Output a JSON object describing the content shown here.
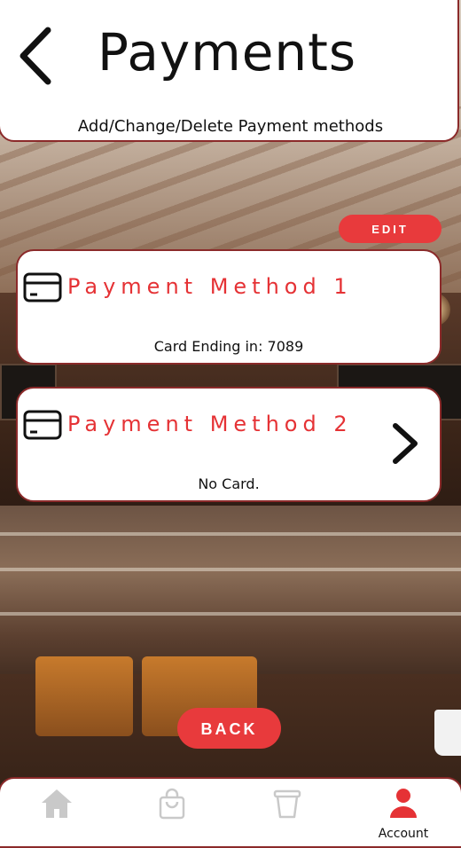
{
  "header": {
    "back_icon": "chevron-left-icon",
    "title": "Payments",
    "subtitle": "Add/Change/Delete Payment methods"
  },
  "actions": {
    "edit_label": "EDIT",
    "back_label": "BACK"
  },
  "payment_methods": [
    {
      "title": "Payment Method 1",
      "detail": "Card Ending in: 7089",
      "icon": "credit-card-icon",
      "has_chevron": false
    },
    {
      "title": "Payment Method 2",
      "detail": "No Card.",
      "icon": "credit-card-icon",
      "has_chevron": true
    }
  ],
  "bottom_nav": {
    "items": [
      {
        "icon": "home-icon",
        "label": "",
        "active": false
      },
      {
        "icon": "shopping-bag-icon",
        "label": "",
        "active": false
      },
      {
        "icon": "coffee-cup-icon",
        "label": "",
        "active": false
      },
      {
        "icon": "account-icon",
        "label": "Account",
        "active": true
      }
    ]
  },
  "colors": {
    "accent": "#e83a3c",
    "border": "#8b2a2a",
    "inactive_icon": "#c9c9c9"
  }
}
